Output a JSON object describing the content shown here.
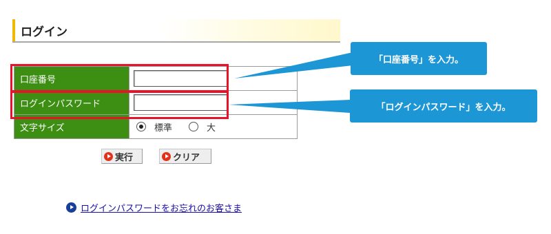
{
  "section": {
    "title": "ログイン"
  },
  "form": {
    "rows": [
      {
        "label": "口座番号"
      },
      {
        "label": "ログインパスワード"
      },
      {
        "label": "文字サイズ"
      }
    ],
    "font_size": {
      "options": [
        "標準",
        "大"
      ],
      "selected": "標準"
    }
  },
  "buttons": {
    "execute": "実行",
    "clear": "クリア"
  },
  "links": {
    "forgot_password": "ログインパスワードをお忘れのお客さま"
  },
  "callouts": {
    "account": "「口座番号」を入力。",
    "password": "「ログインパスワード」を入力。"
  },
  "colors": {
    "label_bg": "#3c8f12",
    "highlight": "#e8132b",
    "callout": "#1c96d5",
    "accent": "#f2b800"
  },
  "icons": {
    "button": "red-play-circle-icon",
    "link": "blue-play-circle-icon"
  }
}
